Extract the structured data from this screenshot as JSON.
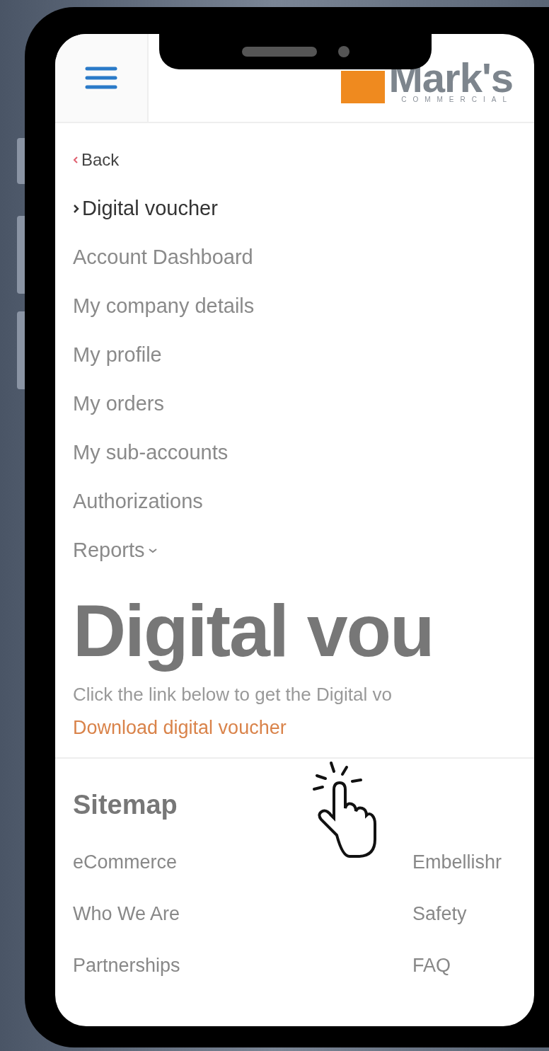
{
  "header": {
    "logo": {
      "name": "Mark's",
      "tagline": "COMMERCIAL"
    }
  },
  "nav": {
    "back": "Back",
    "items": [
      {
        "label": "Digital voucher",
        "selected": true,
        "kind": "link"
      },
      {
        "label": "Account Dashboard",
        "selected": false,
        "kind": "link"
      },
      {
        "label": "My company details",
        "selected": false,
        "kind": "link"
      },
      {
        "label": "My profile",
        "selected": false,
        "kind": "link"
      },
      {
        "label": "My orders",
        "selected": false,
        "kind": "link"
      },
      {
        "label": "My sub-accounts",
        "selected": false,
        "kind": "link"
      },
      {
        "label": "Authorizations",
        "selected": false,
        "kind": "link"
      },
      {
        "label": "Reports",
        "selected": false,
        "kind": "dropdown"
      }
    ]
  },
  "content": {
    "title": "Digital vou",
    "text": "Click the link below to get the Digital vo",
    "link": "Download digital voucher"
  },
  "sitemap": {
    "title": "Sitemap",
    "links": [
      "eCommerce",
      "Embellishr",
      "Who We Are",
      "Safety",
      "Partnerships",
      "FAQ"
    ]
  }
}
